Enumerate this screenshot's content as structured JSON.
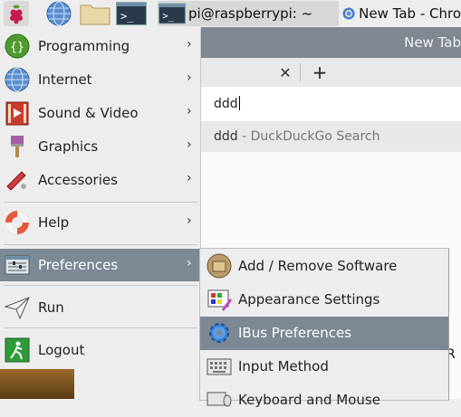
{
  "taskbar": {
    "terminal_title": "pi@raspberrypi: ~",
    "browser_title": "New Tab - Chro"
  },
  "browser": {
    "window_title": "New Tab",
    "omnibox_value": "ddd",
    "suggestion_query": "ddd",
    "suggestion_source": " - DuckDuckGo Search",
    "partial_text": "R"
  },
  "menu": {
    "items": [
      {
        "label": "Programming",
        "arrow": "›"
      },
      {
        "label": "Internet",
        "arrow": "›"
      },
      {
        "label": "Sound & Video",
        "arrow": "›"
      },
      {
        "label": "Graphics",
        "arrow": "›"
      },
      {
        "label": "Accessories",
        "arrow": "›"
      },
      {
        "label": "Help",
        "arrow": "›"
      },
      {
        "label": "Preferences",
        "arrow": "›"
      },
      {
        "label": "Run"
      },
      {
        "label": "Logout"
      }
    ]
  },
  "submenu": {
    "items": [
      {
        "label": "Add / Remove Software"
      },
      {
        "label": "Appearance Settings"
      },
      {
        "label": "IBus Preferences"
      },
      {
        "label": "Input Method"
      },
      {
        "label": "Keyboard and Mouse"
      }
    ]
  },
  "colors": {
    "menu_highlight": "#7c8893",
    "titlebar": "#7f8790"
  }
}
